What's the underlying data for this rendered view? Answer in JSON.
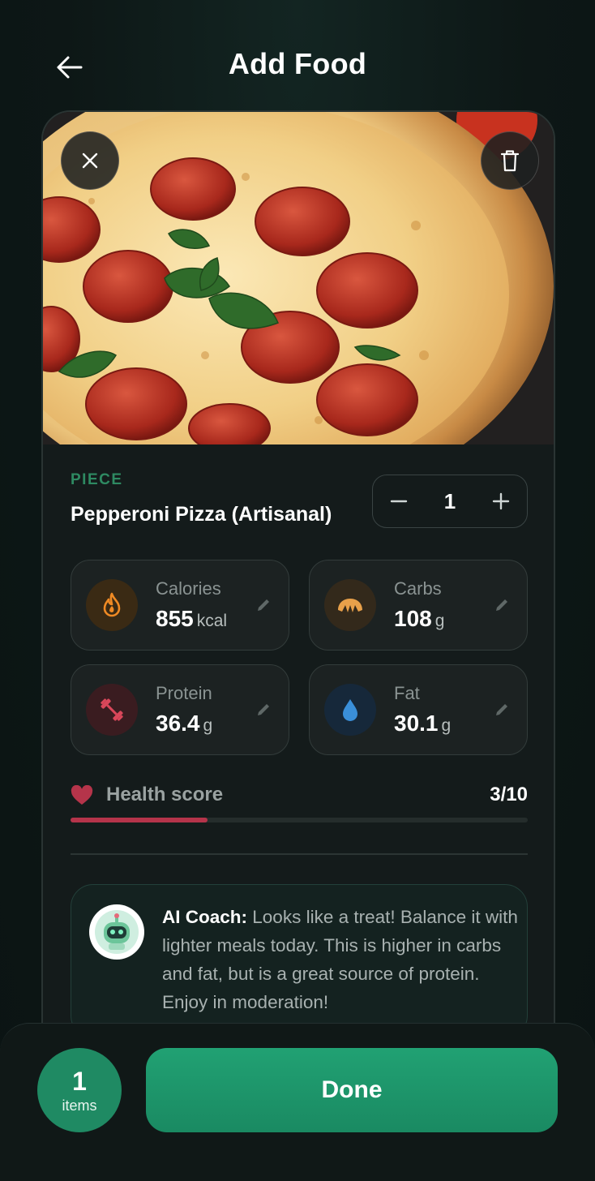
{
  "header": {
    "title": "Add Food",
    "back_icon": "arrow-left-icon"
  },
  "photo": {
    "description_icon": "pizza-photo",
    "close_icon": "close-icon",
    "delete_icon": "trash-icon"
  },
  "food": {
    "unit": "PIECE",
    "name": "Pepperoni Pizza (Artisanal)",
    "quantity": "1"
  },
  "macros": [
    {
      "label": "Calories",
      "value": "855",
      "unit": "kcal",
      "icon": "flame-icon",
      "color": "#f08a24"
    },
    {
      "label": "Carbs",
      "value": "108",
      "unit": "g",
      "icon": "croissant-icon",
      "color": "#e8a04a"
    },
    {
      "label": "Protein",
      "value": "36.4",
      "unit": "g",
      "icon": "dumbbell-icon",
      "color": "#d9475a"
    },
    {
      "label": "Fat",
      "value": "30.1",
      "unit": "g",
      "icon": "droplet-icon",
      "color": "#3a8fd9"
    }
  ],
  "health": {
    "label": "Health score",
    "value_text": "3/10",
    "score": 3,
    "max": 10,
    "color": "#b5344a"
  },
  "coach": {
    "prefix": "AI Coach:",
    "message": "Looks like a treat! Balance it with lighter meals today. This is higher in carbs and fat, but is a great source of protein. Enjoy in moderation!"
  },
  "footer": {
    "items_count": "1",
    "items_label": "items",
    "done_label": "Done",
    "accent": "#1f8a63"
  }
}
